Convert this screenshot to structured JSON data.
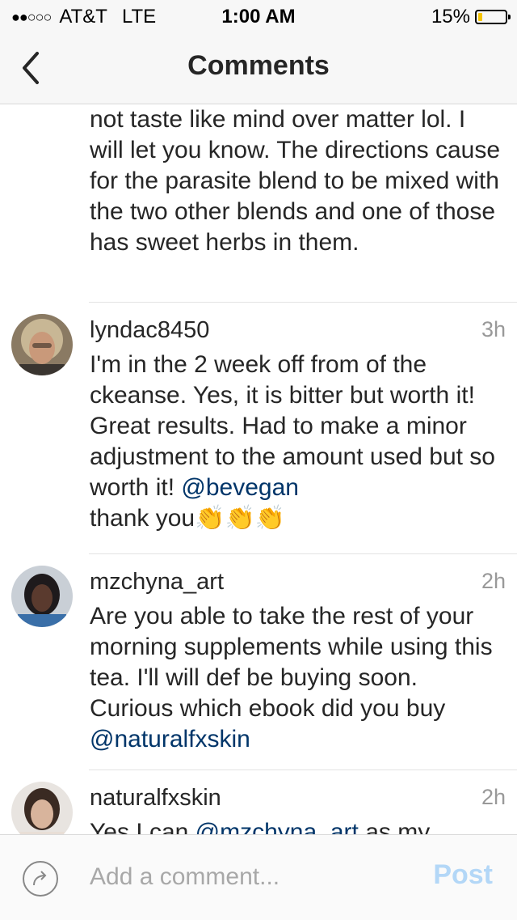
{
  "status_bar": {
    "carrier": "AT&T",
    "network": "LTE",
    "time": "1:00 AM",
    "battery": "15%",
    "battery_level": 0.15,
    "signal_dots": "●●○○○"
  },
  "nav": {
    "title": "Comments",
    "back_icon": "chevron-left-icon"
  },
  "comments": [
    {
      "text": "not taste like mind over matter lol. I will let you know. The directions cause for the parasite blend to be mixed with the two other blends and one of those has sweet herbs in them."
    },
    {
      "username": "lyndac8450",
      "time": "3h",
      "text": "I'm in the 2 week off from of the ckeanse. Yes, it is bitter but worth it! Great results. Had to make a minor adjustment to the amount used but so worth it! ",
      "mention": "@bevegan",
      "text_after": " thank you",
      "emoji": "👏👏👏"
    },
    {
      "username": "mzchyna_art",
      "time": "2h",
      "text": "Are you able to take the rest of your morning supplements while using this tea. I'll will def be buying soon. Curious which ebook did you buy ",
      "mention": "@naturalfxskin"
    },
    {
      "username": "naturalfxskin",
      "time": "2h",
      "text": "Yes I can ",
      "mention": "@mzchyna_art",
      "text_after": " as my"
    }
  ],
  "input": {
    "placeholder": "Add a comment...",
    "post_label": "Post",
    "share_icon": "share-arrow-icon"
  },
  "colors": {
    "mention": "#003569",
    "timestamp": "#999999",
    "post_disabled": "#b3d7f7",
    "battery_low": "#f5c400"
  }
}
